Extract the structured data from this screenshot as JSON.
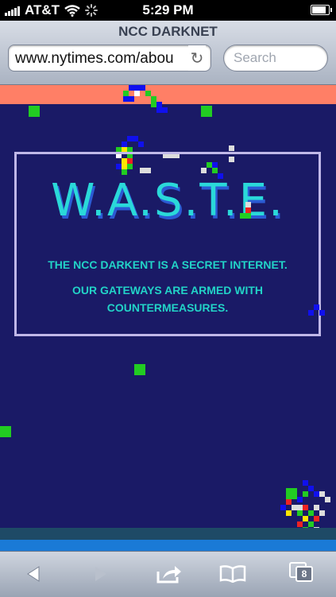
{
  "status_bar": {
    "carrier": "AT&T",
    "time": "5:29 PM"
  },
  "browser": {
    "page_title": "NCC DARKNET",
    "url": "www.nytimes.com/abou",
    "search_placeholder": "Search",
    "tab_count": "8"
  },
  "page": {
    "logo": "W.A.S.T.E.",
    "line1": "THE NCC DARKENT IS A SECRET INTERNET.",
    "line2a": "OUR GATEWAYS ARE ARMED WITH",
    "line2b": "COUNTERMEASURES."
  },
  "colors": {
    "background": "#1a1a66",
    "banner": "#ff7f66",
    "text_accent": "#22d3c7",
    "panel_border": "#c0b8e8"
  }
}
